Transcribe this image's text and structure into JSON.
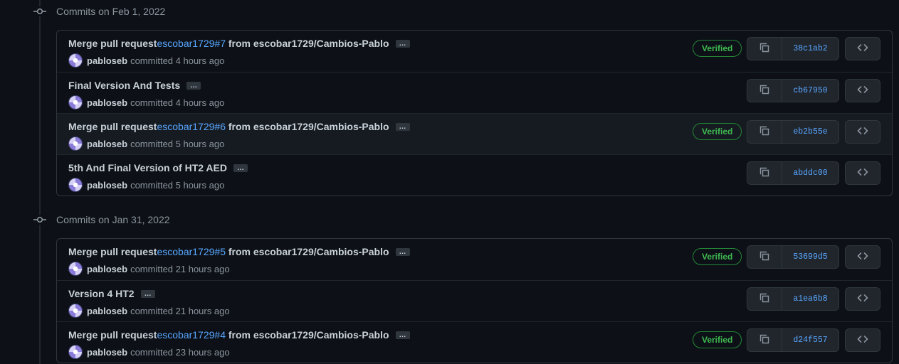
{
  "groups": [
    {
      "header": "Commits on Feb 1, 2022",
      "commits": [
        {
          "prefix": "Merge pull request ",
          "link": "escobar1729#7",
          "suffix": " from escobar1729/Cambios-Pablo",
          "author": "pabloseb",
          "time": "committed 4 hours ago",
          "verified": "Verified",
          "sha": "38c1ab2"
        },
        {
          "prefix": "Final Version And Tests",
          "link": "",
          "suffix": "",
          "author": "pabloseb",
          "time": "committed 4 hours ago",
          "verified": "",
          "sha": "cb67950"
        },
        {
          "prefix": "Merge pull request ",
          "link": "escobar1729#6",
          "suffix": " from escobar1729/Cambios-Pablo",
          "author": "pabloseb",
          "time": "committed 5 hours ago",
          "verified": "Verified",
          "sha": "eb2b55e"
        },
        {
          "prefix": "5th And Final Version of HT2 AED",
          "link": "",
          "suffix": "",
          "author": "pabloseb",
          "time": "committed 5 hours ago",
          "verified": "",
          "sha": "abddc00"
        }
      ]
    },
    {
      "header": "Commits on Jan 31, 2022",
      "commits": [
        {
          "prefix": "Merge pull request ",
          "link": "escobar1729#5",
          "suffix": " from escobar1729/Cambios-Pablo",
          "author": "pabloseb",
          "time": "committed 21 hours ago",
          "verified": "Verified",
          "sha": "53699d5"
        },
        {
          "prefix": "Version 4 HT2",
          "link": "",
          "suffix": "",
          "author": "pabloseb",
          "time": "committed 21 hours ago",
          "verified": "",
          "sha": "a1ea6b8"
        },
        {
          "prefix": "Merge pull request ",
          "link": "escobar1729#4",
          "suffix": " from escobar1729/Cambios-Pablo",
          "author": "pabloseb",
          "time": "committed 23 hours ago",
          "verified": "Verified",
          "sha": "d24f557"
        }
      ]
    }
  ],
  "ellipsis_label": "…",
  "icons": {
    "commit": "git-commit-icon",
    "copy": "copy-icon",
    "browse": "code-icon"
  },
  "colors": {
    "background": "#0d1117",
    "link": "#58a6ff",
    "verified": "#3fb950",
    "border": "#30363d"
  }
}
